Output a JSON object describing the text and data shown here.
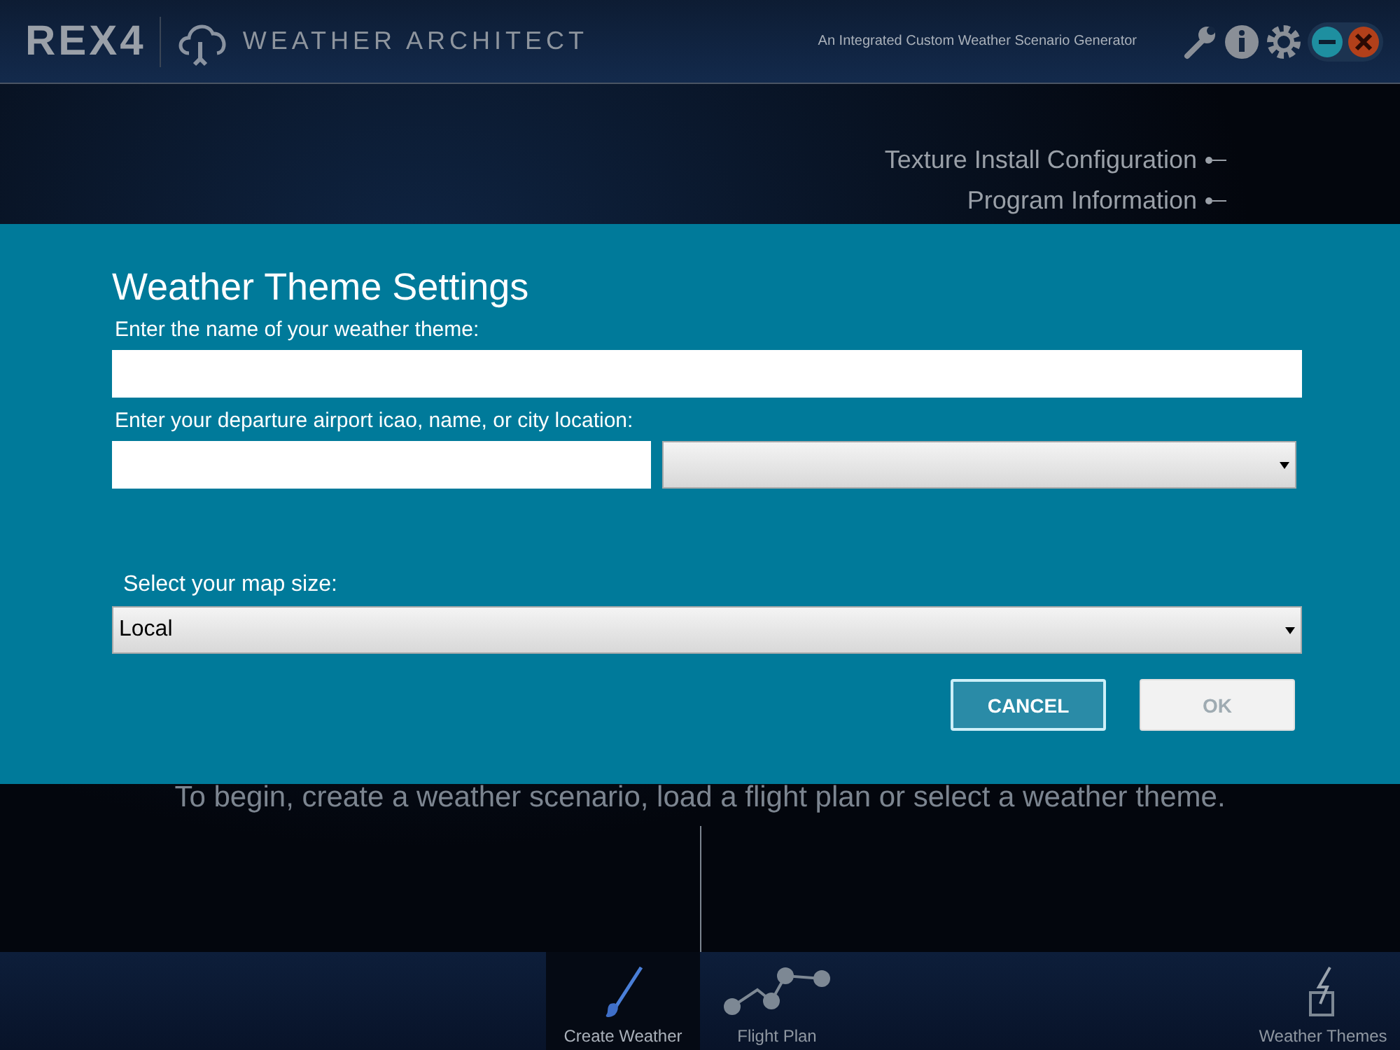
{
  "header": {
    "logo": "REX4",
    "product": "WEATHER ARCHITECT",
    "tagline": "An Integrated Custom Weather Scenario Generator"
  },
  "menu_links": [
    "Texture Install Configuration",
    "Program Information"
  ],
  "intro": "To begin, create a weather scenario, load a flight plan or select a weather theme.",
  "dialog": {
    "title": "Weather Theme Settings",
    "name_label": "Enter the name of your weather theme:",
    "airport_label": "Enter your departure airport icao, name, or city location:",
    "map_label": "Select your map size:",
    "map_value": "Local",
    "buttons": [
      {
        "label": "CANCEL",
        "kind": "secondary",
        "disabled": false
      },
      {
        "label": "OK",
        "kind": "primary",
        "disabled": true
      }
    ]
  },
  "nav": [
    {
      "label": "Create Weather",
      "kind": "brush",
      "selected": true
    },
    {
      "label": "Flight Plan",
      "kind": "route",
      "selected": false
    },
    {
      "label": "Weather Themes",
      "kind": "theme",
      "selected": false
    }
  ]
}
